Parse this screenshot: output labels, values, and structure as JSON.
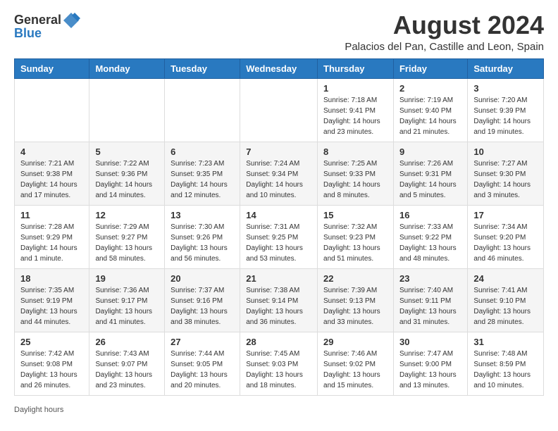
{
  "header": {
    "logo_general": "General",
    "logo_blue": "Blue",
    "month_year": "August 2024",
    "location": "Palacios del Pan, Castille and Leon, Spain"
  },
  "calendar": {
    "days_of_week": [
      "Sunday",
      "Monday",
      "Tuesday",
      "Wednesday",
      "Thursday",
      "Friday",
      "Saturday"
    ],
    "weeks": [
      [
        {
          "day": "",
          "info": ""
        },
        {
          "day": "",
          "info": ""
        },
        {
          "day": "",
          "info": ""
        },
        {
          "day": "",
          "info": ""
        },
        {
          "day": "1",
          "info": "Sunrise: 7:18 AM\nSunset: 9:41 PM\nDaylight: 14 hours and 23 minutes."
        },
        {
          "day": "2",
          "info": "Sunrise: 7:19 AM\nSunset: 9:40 PM\nDaylight: 14 hours and 21 minutes."
        },
        {
          "day": "3",
          "info": "Sunrise: 7:20 AM\nSunset: 9:39 PM\nDaylight: 14 hours and 19 minutes."
        }
      ],
      [
        {
          "day": "4",
          "info": "Sunrise: 7:21 AM\nSunset: 9:38 PM\nDaylight: 14 hours and 17 minutes."
        },
        {
          "day": "5",
          "info": "Sunrise: 7:22 AM\nSunset: 9:36 PM\nDaylight: 14 hours and 14 minutes."
        },
        {
          "day": "6",
          "info": "Sunrise: 7:23 AM\nSunset: 9:35 PM\nDaylight: 14 hours and 12 minutes."
        },
        {
          "day": "7",
          "info": "Sunrise: 7:24 AM\nSunset: 9:34 PM\nDaylight: 14 hours and 10 minutes."
        },
        {
          "day": "8",
          "info": "Sunrise: 7:25 AM\nSunset: 9:33 PM\nDaylight: 14 hours and 8 minutes."
        },
        {
          "day": "9",
          "info": "Sunrise: 7:26 AM\nSunset: 9:31 PM\nDaylight: 14 hours and 5 minutes."
        },
        {
          "day": "10",
          "info": "Sunrise: 7:27 AM\nSunset: 9:30 PM\nDaylight: 14 hours and 3 minutes."
        }
      ],
      [
        {
          "day": "11",
          "info": "Sunrise: 7:28 AM\nSunset: 9:29 PM\nDaylight: 14 hours and 1 minute."
        },
        {
          "day": "12",
          "info": "Sunrise: 7:29 AM\nSunset: 9:27 PM\nDaylight: 13 hours and 58 minutes."
        },
        {
          "day": "13",
          "info": "Sunrise: 7:30 AM\nSunset: 9:26 PM\nDaylight: 13 hours and 56 minutes."
        },
        {
          "day": "14",
          "info": "Sunrise: 7:31 AM\nSunset: 9:25 PM\nDaylight: 13 hours and 53 minutes."
        },
        {
          "day": "15",
          "info": "Sunrise: 7:32 AM\nSunset: 9:23 PM\nDaylight: 13 hours and 51 minutes."
        },
        {
          "day": "16",
          "info": "Sunrise: 7:33 AM\nSunset: 9:22 PM\nDaylight: 13 hours and 48 minutes."
        },
        {
          "day": "17",
          "info": "Sunrise: 7:34 AM\nSunset: 9:20 PM\nDaylight: 13 hours and 46 minutes."
        }
      ],
      [
        {
          "day": "18",
          "info": "Sunrise: 7:35 AM\nSunset: 9:19 PM\nDaylight: 13 hours and 44 minutes."
        },
        {
          "day": "19",
          "info": "Sunrise: 7:36 AM\nSunset: 9:17 PM\nDaylight: 13 hours and 41 minutes."
        },
        {
          "day": "20",
          "info": "Sunrise: 7:37 AM\nSunset: 9:16 PM\nDaylight: 13 hours and 38 minutes."
        },
        {
          "day": "21",
          "info": "Sunrise: 7:38 AM\nSunset: 9:14 PM\nDaylight: 13 hours and 36 minutes."
        },
        {
          "day": "22",
          "info": "Sunrise: 7:39 AM\nSunset: 9:13 PM\nDaylight: 13 hours and 33 minutes."
        },
        {
          "day": "23",
          "info": "Sunrise: 7:40 AM\nSunset: 9:11 PM\nDaylight: 13 hours and 31 minutes."
        },
        {
          "day": "24",
          "info": "Sunrise: 7:41 AM\nSunset: 9:10 PM\nDaylight: 13 hours and 28 minutes."
        }
      ],
      [
        {
          "day": "25",
          "info": "Sunrise: 7:42 AM\nSunset: 9:08 PM\nDaylight: 13 hours and 26 minutes."
        },
        {
          "day": "26",
          "info": "Sunrise: 7:43 AM\nSunset: 9:07 PM\nDaylight: 13 hours and 23 minutes."
        },
        {
          "day": "27",
          "info": "Sunrise: 7:44 AM\nSunset: 9:05 PM\nDaylight: 13 hours and 20 minutes."
        },
        {
          "day": "28",
          "info": "Sunrise: 7:45 AM\nSunset: 9:03 PM\nDaylight: 13 hours and 18 minutes."
        },
        {
          "day": "29",
          "info": "Sunrise: 7:46 AM\nSunset: 9:02 PM\nDaylight: 13 hours and 15 minutes."
        },
        {
          "day": "30",
          "info": "Sunrise: 7:47 AM\nSunset: 9:00 PM\nDaylight: 13 hours and 13 minutes."
        },
        {
          "day": "31",
          "info": "Sunrise: 7:48 AM\nSunset: 8:59 PM\nDaylight: 13 hours and 10 minutes."
        }
      ]
    ]
  },
  "footer": {
    "text": "Daylight hours"
  }
}
